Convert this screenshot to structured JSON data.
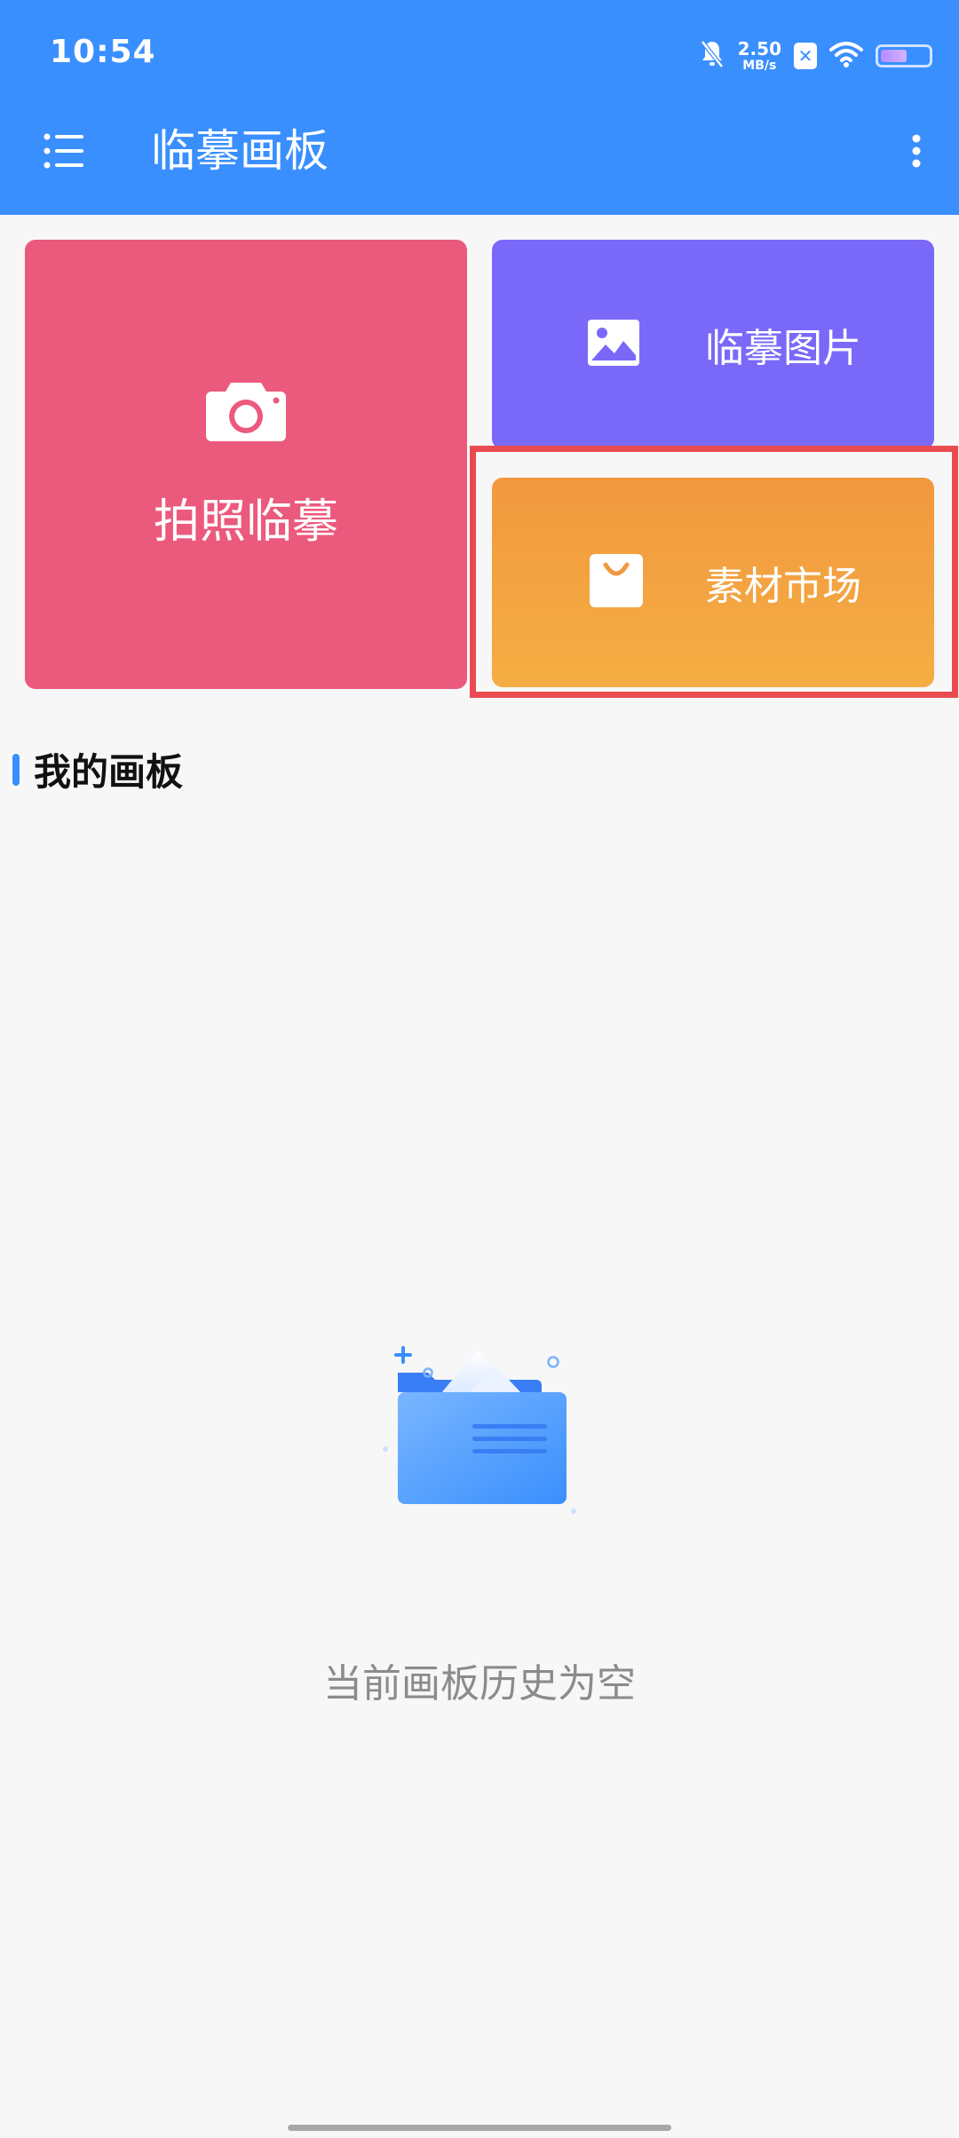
{
  "status_bar": {
    "time": "10:54",
    "net_speed_value": "2.50",
    "net_speed_unit": "MB/s",
    "sim_badge": "✕",
    "battery_level": 0.55
  },
  "app_bar": {
    "title": "临摹画板",
    "menu_icon": "list-menu-icon",
    "more_icon": "more-vert-icon"
  },
  "cards": {
    "photo": {
      "label": "拍照临摹",
      "icon": "camera-icon",
      "color": "#eb5a7d"
    },
    "image": {
      "label": "临摹图片",
      "icon": "image-icon",
      "color": "#7a69f9"
    },
    "market": {
      "label": "素材市场",
      "icon": "shopping-bag-icon",
      "color": "#f4a040"
    }
  },
  "section": {
    "title": "我的画板",
    "accent": "#3a8ffe"
  },
  "empty_state": {
    "message": "当前画板历史为空",
    "icon": "empty-folder-icon"
  },
  "highlight_color": "#e94b50"
}
